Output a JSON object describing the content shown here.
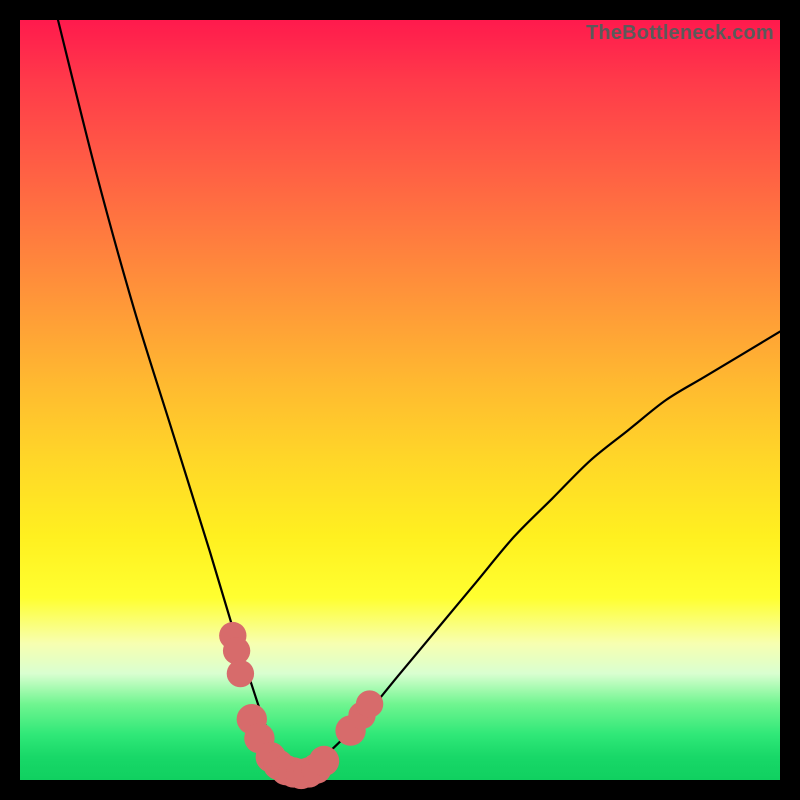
{
  "watermark": "TheBottleneck.com",
  "chart_data": {
    "type": "line",
    "title": "",
    "xlabel": "",
    "ylabel": "",
    "xlim": [
      0,
      100
    ],
    "ylim": [
      0,
      100
    ],
    "series": [
      {
        "name": "bottleneck-curve",
        "x": [
          5,
          10,
          15,
          20,
          25,
          28,
          30,
          32,
          34,
          36,
          37,
          38,
          40,
          45,
          50,
          55,
          60,
          65,
          70,
          75,
          80,
          85,
          90,
          95,
          100
        ],
        "y": [
          100,
          80,
          62,
          46,
          30,
          20,
          14,
          8,
          3,
          1,
          0.5,
          1,
          3,
          8,
          14,
          20,
          26,
          32,
          37,
          42,
          46,
          50,
          53,
          56,
          59
        ]
      }
    ],
    "markers": [
      {
        "name": "marker-1",
        "x": 28.0,
        "y": 19.0,
        "r": 1.8
      },
      {
        "name": "marker-2",
        "x": 28.5,
        "y": 17.0,
        "r": 1.8
      },
      {
        "name": "marker-3",
        "x": 29.0,
        "y": 14.0,
        "r": 1.8
      },
      {
        "name": "marker-4",
        "x": 30.5,
        "y": 8.0,
        "r": 2.0
      },
      {
        "name": "marker-5",
        "x": 31.5,
        "y": 5.5,
        "r": 2.0
      },
      {
        "name": "marker-6",
        "x": 33.0,
        "y": 3.0,
        "r": 2.0
      },
      {
        "name": "marker-7",
        "x": 34.0,
        "y": 2.0,
        "r": 2.0
      },
      {
        "name": "marker-8",
        "x": 35.0,
        "y": 1.3,
        "r": 2.0
      },
      {
        "name": "marker-9",
        "x": 36.0,
        "y": 1.0,
        "r": 2.0
      },
      {
        "name": "marker-10",
        "x": 37.0,
        "y": 0.8,
        "r": 2.0
      },
      {
        "name": "marker-11",
        "x": 38.0,
        "y": 1.0,
        "r": 2.0
      },
      {
        "name": "marker-12",
        "x": 39.0,
        "y": 1.5,
        "r": 2.0
      },
      {
        "name": "marker-13",
        "x": 40.0,
        "y": 2.5,
        "r": 2.0
      },
      {
        "name": "marker-14",
        "x": 43.5,
        "y": 6.5,
        "r": 2.0
      },
      {
        "name": "marker-15",
        "x": 45.0,
        "y": 8.5,
        "r": 1.8
      },
      {
        "name": "marker-16",
        "x": 46.0,
        "y": 10.0,
        "r": 1.8
      }
    ],
    "marker_color": "#d76b6b"
  }
}
